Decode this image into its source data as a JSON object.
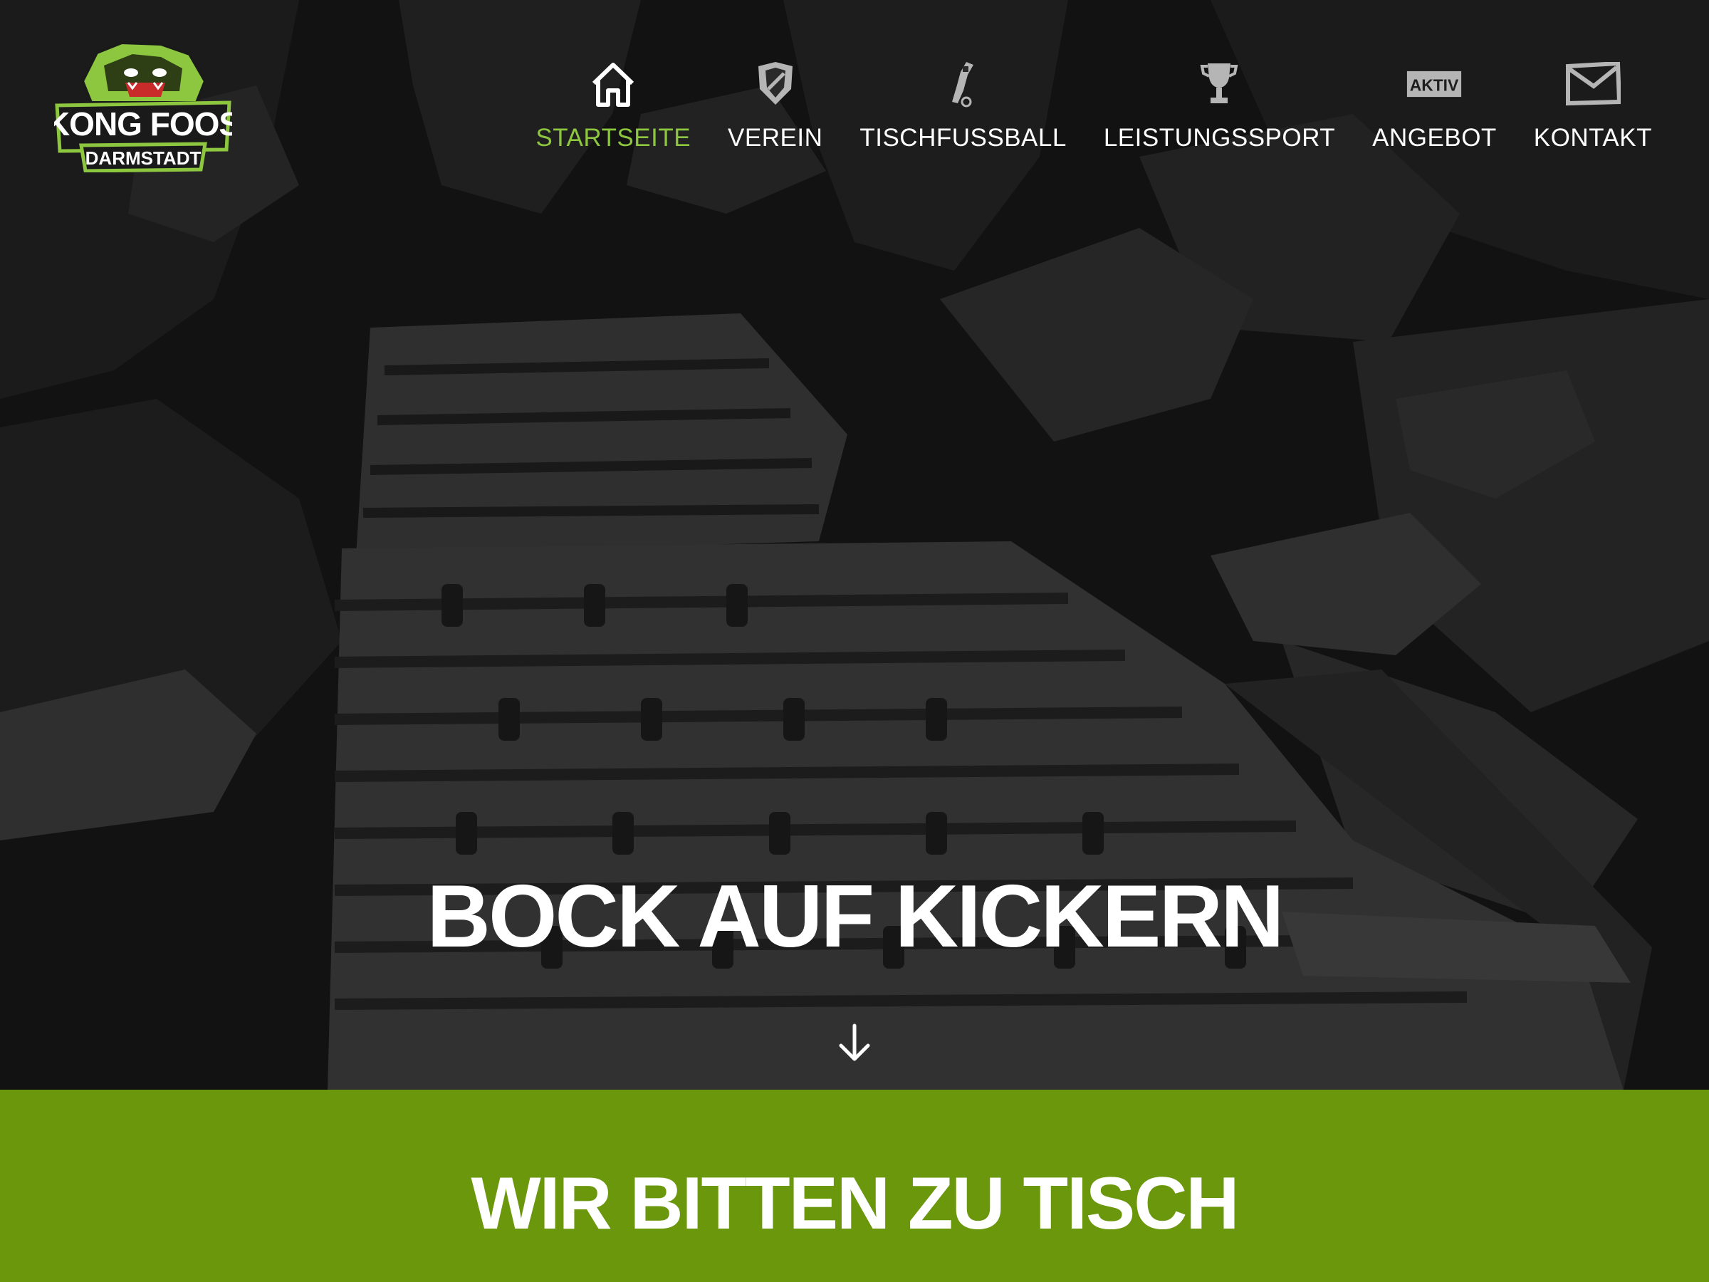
{
  "brand": {
    "logo_line1": "KONG FOOS",
    "logo_line2": "DARMSTADT",
    "logo_icon": "gorilla-icon"
  },
  "colors": {
    "accent": "#8dc63f",
    "band": "#6a970c",
    "nav_text": "#ffffff",
    "icon_gray": "#b5b5b5"
  },
  "nav": {
    "items": [
      {
        "label": "STARTSEITE",
        "icon": "home-icon",
        "active": true
      },
      {
        "label": "VEREIN",
        "icon": "club-crest-icon",
        "active": false
      },
      {
        "label": "TISCHFUSSBALL",
        "icon": "foosball-player-icon",
        "active": false
      },
      {
        "label": "LEISTUNGSSPORT",
        "icon": "trophy-icon",
        "active": false
      },
      {
        "label": "ANGEBOT",
        "icon": "aktiv-badge-icon",
        "badge": "AKTIV",
        "active": false
      },
      {
        "label": "KONTAKT",
        "icon": "envelope-icon",
        "active": false
      }
    ]
  },
  "hero": {
    "title": "BOCK AUF KICKERN",
    "scroll_icon": "arrow-down-icon"
  },
  "section": {
    "title": "WIR BITTEN ZU TISCH"
  }
}
